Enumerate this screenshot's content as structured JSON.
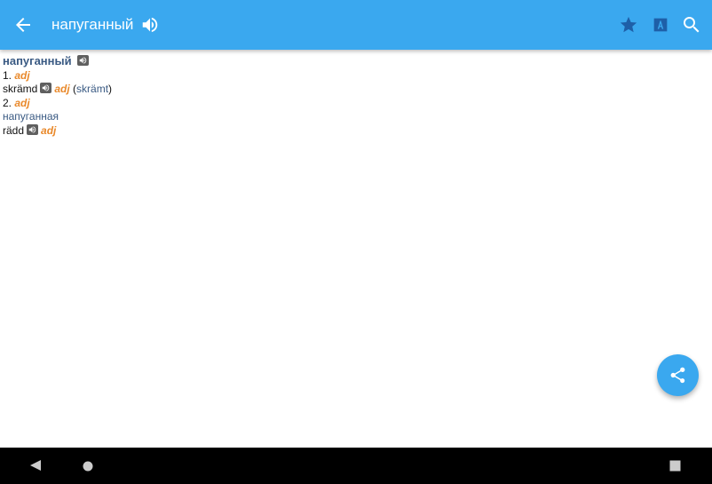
{
  "appbar": {
    "title": "напуганный",
    "icons": [
      "back-arrow-icon",
      "speaker-icon",
      "star-icon",
      "transliteration-icon",
      "search-icon"
    ],
    "color": "#3aa8ef"
  },
  "entry": {
    "headword": "напуганный",
    "senses": [
      {
        "number": "1.",
        "pos": "adj",
        "translation": "skrämd",
        "pos2": "adj",
        "variant": "skrämt",
        "paren_open": "(",
        "paren_close": ")"
      },
      {
        "number": "2.",
        "pos": "adj",
        "form": "напуганная",
        "translation": "rädd",
        "pos2": "adj"
      }
    ]
  },
  "fab": {
    "icon": "share-icon"
  },
  "navbar": {
    "icons": [
      "back-triangle-icon",
      "home-circle-icon",
      "recents-square-icon"
    ]
  },
  "colors": {
    "accent": "#3aa8ef",
    "pos": "#e9892b",
    "link": "#3a5a83"
  }
}
